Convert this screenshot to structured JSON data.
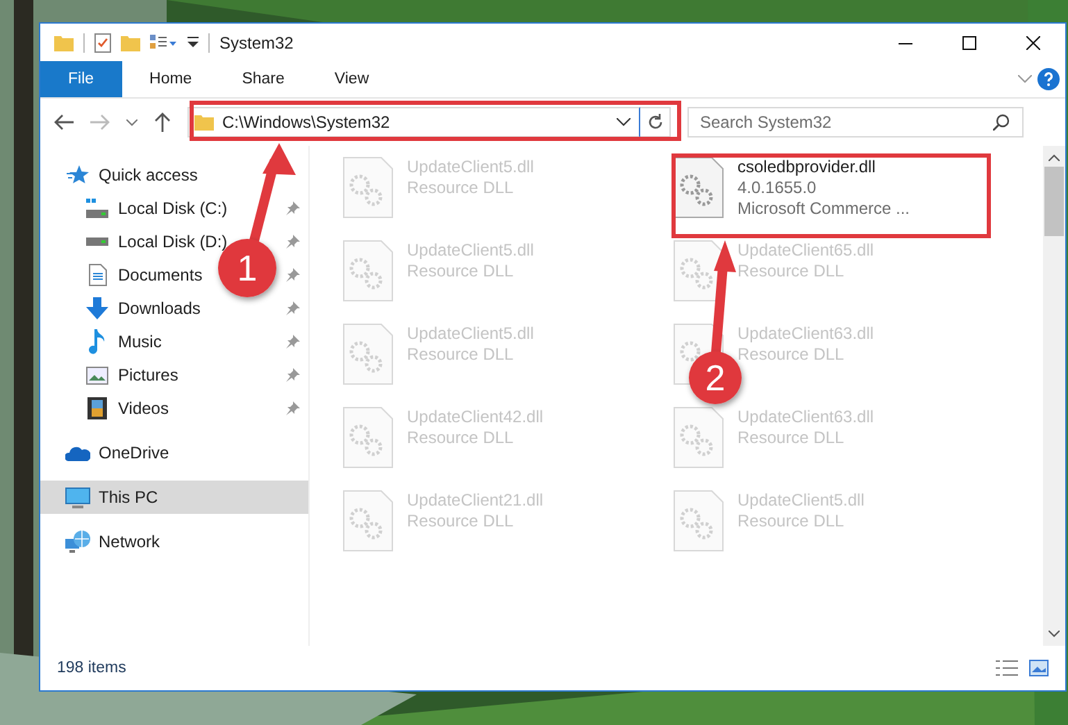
{
  "window": {
    "title": "System32"
  },
  "ribbon": {
    "tabs": [
      {
        "label": "File",
        "selected": true
      },
      {
        "label": "Home",
        "selected": false
      },
      {
        "label": "Share",
        "selected": false
      },
      {
        "label": "View",
        "selected": false
      }
    ]
  },
  "address_bar": {
    "path": "C:\\Windows\\System32"
  },
  "search": {
    "placeholder": "Search System32"
  },
  "sidebar": {
    "items": [
      {
        "label": "Quick access",
        "kind": "star",
        "selected": false,
        "children": [
          {
            "label": "Local Disk (C:)",
            "kind": "drive-system",
            "pinned": true,
            "selected": false
          },
          {
            "label": "Local Disk (D:)",
            "kind": "drive",
            "pinned": true,
            "selected": false
          },
          {
            "label": "Documents",
            "kind": "document",
            "pinned": true,
            "selected": false
          },
          {
            "label": "Downloads",
            "kind": "download",
            "pinned": true,
            "selected": false
          },
          {
            "label": "Music",
            "kind": "music",
            "pinned": true,
            "selected": false
          },
          {
            "label": "Pictures",
            "kind": "pictures",
            "pinned": true,
            "selected": false
          },
          {
            "label": "Videos",
            "kind": "video",
            "pinned": true,
            "selected": false
          }
        ]
      },
      {
        "label": "OneDrive",
        "kind": "cloud",
        "selected": false
      },
      {
        "label": "This PC",
        "kind": "computer",
        "selected": true
      },
      {
        "label": "Network",
        "kind": "network",
        "selected": false
      }
    ]
  },
  "files": [
    {
      "name": "UpdateClient5.dll",
      "details": [
        "Resource DLL"
      ],
      "blurred": true
    },
    {
      "name": "UpdateClient5.dll",
      "details": [
        "Resource DLL"
      ],
      "blurred": true
    },
    {
      "name": "UpdateClient5.dll",
      "details": [
        "Resource DLL"
      ],
      "blurred": true
    },
    {
      "name": "UpdateClient42.dll",
      "details": [
        "Resource DLL"
      ],
      "blurred": true
    },
    {
      "name": "UpdateClient21.dll",
      "details": [
        "Resource DLL"
      ],
      "blurred": true
    },
    {
      "name": "csoledbprovider.dll",
      "details": [
        "4.0.1655.0",
        "Microsoft Commerce ..."
      ],
      "blurred": false
    },
    {
      "name": "UpdateClient65.dll",
      "details": [
        "Resource DLL"
      ],
      "blurred": true
    },
    {
      "name": "UpdateClient63.dll",
      "details": [
        "Resource DLL"
      ],
      "blurred": true
    },
    {
      "name": "UpdateClient63.dll",
      "details": [
        "Resource DLL"
      ],
      "blurred": true
    },
    {
      "name": "UpdateClient5.dll",
      "details": [
        "Resource DLL"
      ],
      "blurred": true
    }
  ],
  "status_bar": {
    "item_count": "198 items"
  },
  "annotations": [
    {
      "number": "1"
    },
    {
      "number": "2"
    }
  ]
}
